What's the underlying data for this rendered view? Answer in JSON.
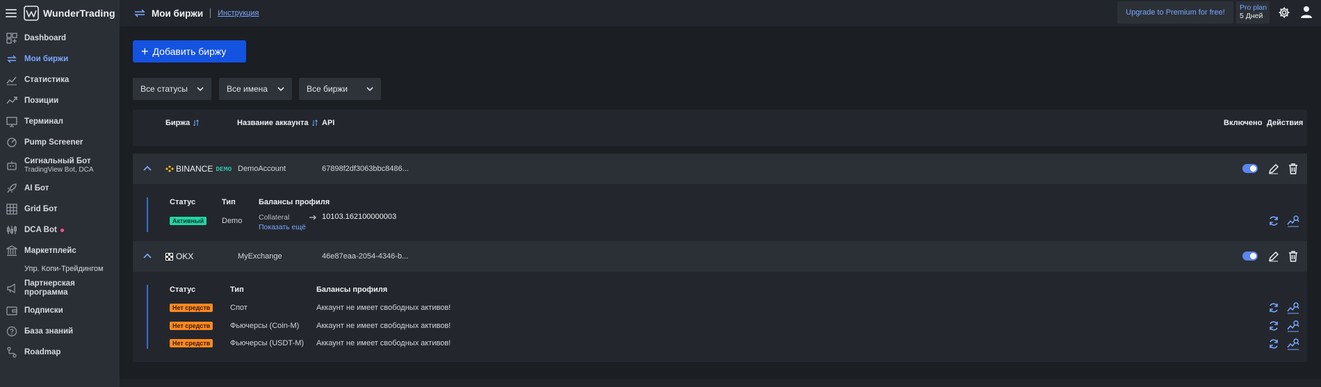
{
  "brand": {
    "name": "WunderTrading"
  },
  "sidebar": {
    "items": [
      {
        "label": "Dashboard",
        "icon": "dashboard-icon"
      },
      {
        "label": "Мои биржи",
        "icon": "exchange-arrows-icon",
        "active": true
      },
      {
        "label": "Статистика",
        "icon": "statistics-icon"
      },
      {
        "label": "Позиции",
        "icon": "positions-icon"
      },
      {
        "label": "Терминал",
        "icon": "terminal-icon"
      },
      {
        "label": "Pump Screener",
        "icon": "pump-screener-icon"
      },
      {
        "label": "Сигнальный Бот",
        "sub": "TradingView Bot, DCA",
        "icon": "signal-bot-icon"
      },
      {
        "label": "AI Бот",
        "icon": "rocket-icon"
      },
      {
        "label": "Grid Бот",
        "icon": "grid-icon"
      },
      {
        "label": "DCA Bot",
        "icon": "dca-icon"
      },
      {
        "label": "Маркетплейс",
        "icon": "marketplace-icon"
      },
      {
        "label": "Упр. Копи-Трейдингом"
      },
      {
        "label": "Партнерская программа",
        "icon": "megaphone-icon"
      },
      {
        "label": "Подписки",
        "icon": "wallet-icon"
      },
      {
        "label": "База знаний",
        "icon": "help-icon"
      },
      {
        "label": "Roadmap",
        "icon": "roadmap-icon"
      }
    ]
  },
  "topbar": {
    "title": "Мои биржи",
    "link": "Инструкция",
    "upgrade": "Upgrade to Premium for free!",
    "plan_name": "Pro plan",
    "plan_days": "5 Дней"
  },
  "main": {
    "add_button": "Добавить биржу",
    "filters": [
      "Все статусы",
      "Все имена",
      "Все биржи"
    ]
  },
  "table": {
    "headers": {
      "exchange": "Биржа",
      "account": "Название аккаунта",
      "api": "API",
      "enabled": "Включено",
      "actions": "Действия"
    },
    "rows": [
      {
        "exchange": "BINANCE",
        "tag": "DEMO",
        "account": "DemoAccount",
        "api": "67898f2df3063bbc8486...",
        "sub_headers": {
          "status": "Статус",
          "type": "Тип",
          "balances": "Балансы профиля"
        },
        "sub_rows": [
          {
            "status": "Активный",
            "type": "Demo",
            "asset": "Collateral",
            "amount": "10103.162100000003",
            "more": "Показать ещё"
          }
        ]
      },
      {
        "exchange": "OKX",
        "account": "MyExchange",
        "api": "46e87eaa-2054-4346-b...",
        "sub_headers": {
          "status": "Статус",
          "type": "Тип",
          "balances": "Балансы профиля"
        },
        "sub_rows": [
          {
            "status": "Нет средств",
            "type": "Спот",
            "balance": "Аккаунт не имеет свободных активов!"
          },
          {
            "status": "Нет средств",
            "type": "Фьючерсы (Coin-M)",
            "balance": "Аккаунт не имеет свободных активов!"
          },
          {
            "status": "Нет средств",
            "type": "Фьючерсы (USDT-M)",
            "balance": "Аккаунт не имеет свободных активов!"
          }
        ]
      }
    ]
  },
  "colors": {
    "accent": "#1452e0",
    "link": "#7aa7ff",
    "active": "#23d6a5",
    "warning": "#ff8a1f"
  }
}
